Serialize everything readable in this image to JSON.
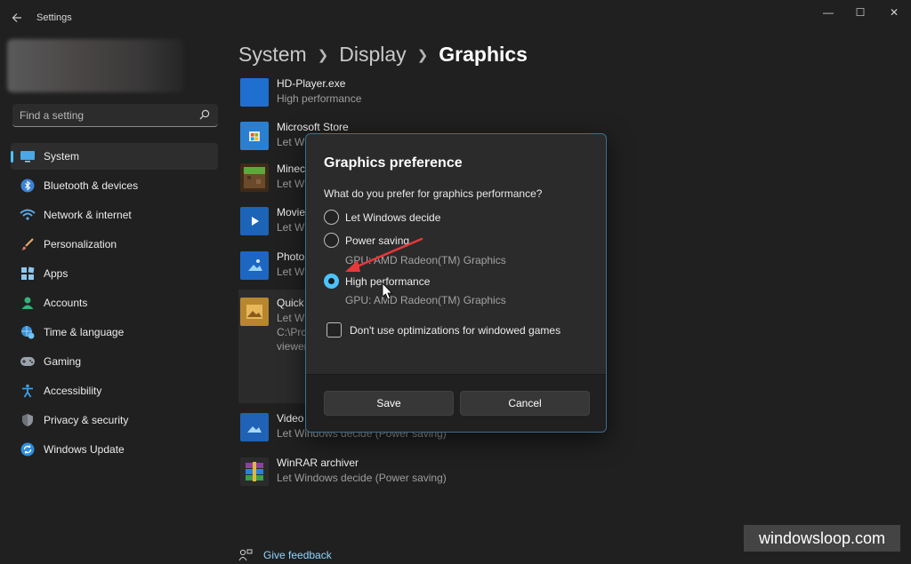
{
  "window": {
    "title": "Settings",
    "controls": {
      "minimize": "—",
      "maximize": "☐",
      "close": "✕"
    }
  },
  "sidebar": {
    "search_placeholder": "Find a setting",
    "items": [
      {
        "label": "System",
        "icon": "monitor-icon",
        "active": true
      },
      {
        "label": "Bluetooth & devices",
        "icon": "bluetooth-icon"
      },
      {
        "label": "Network & internet",
        "icon": "wifi-icon"
      },
      {
        "label": "Personalization",
        "icon": "brush-icon"
      },
      {
        "label": "Apps",
        "icon": "apps-icon"
      },
      {
        "label": "Accounts",
        "icon": "person-icon"
      },
      {
        "label": "Time & language",
        "icon": "globe-clock-icon"
      },
      {
        "label": "Gaming",
        "icon": "gamepad-icon"
      },
      {
        "label": "Accessibility",
        "icon": "accessibility-icon"
      },
      {
        "label": "Privacy & security",
        "icon": "shield-icon"
      },
      {
        "label": "Windows Update",
        "icon": "update-icon"
      }
    ]
  },
  "breadcrumb": {
    "items": [
      "System",
      "Display"
    ],
    "current": "Graphics"
  },
  "apps": [
    {
      "name": "HD-Player.exe",
      "sub": "High performance"
    },
    {
      "name": "Microsoft Store",
      "sub": "Let Wi"
    },
    {
      "name": "Minec",
      "sub": "Let Wi"
    },
    {
      "name": "Movie",
      "sub": "Let Wi"
    },
    {
      "name": "Photos",
      "sub": "Let Wi"
    },
    {
      "name": "Quick",
      "sub": "Let Wi",
      "extra1": "C:\\Pro",
      "extra2": "viewer"
    },
    {
      "name": "Video",
      "sub": "Let Windows decide (Power saving)"
    },
    {
      "name": "WinRAR archiver",
      "sub": "Let Windows decide (Power saving)"
    }
  ],
  "feedback": "Give feedback",
  "dialog": {
    "title": "Graphics preference",
    "question": "What do you prefer for graphics performance?",
    "options": [
      {
        "label": "Let Windows decide"
      },
      {
        "label": "Power saving",
        "gpu": "GPU: AMD Radeon(TM) Graphics"
      },
      {
        "label": "High performance",
        "gpu": "GPU: AMD Radeon(TM) Graphics",
        "selected": true
      }
    ],
    "checkbox_label": "Don't use optimizations for windowed games",
    "checkbox_checked": false,
    "save": "Save",
    "cancel": "Cancel"
  },
  "watermark": "windowsloop.com",
  "colors": {
    "accent": "#4cc2ff",
    "annotation_arrow": "#e8383a",
    "background": "#202020"
  }
}
